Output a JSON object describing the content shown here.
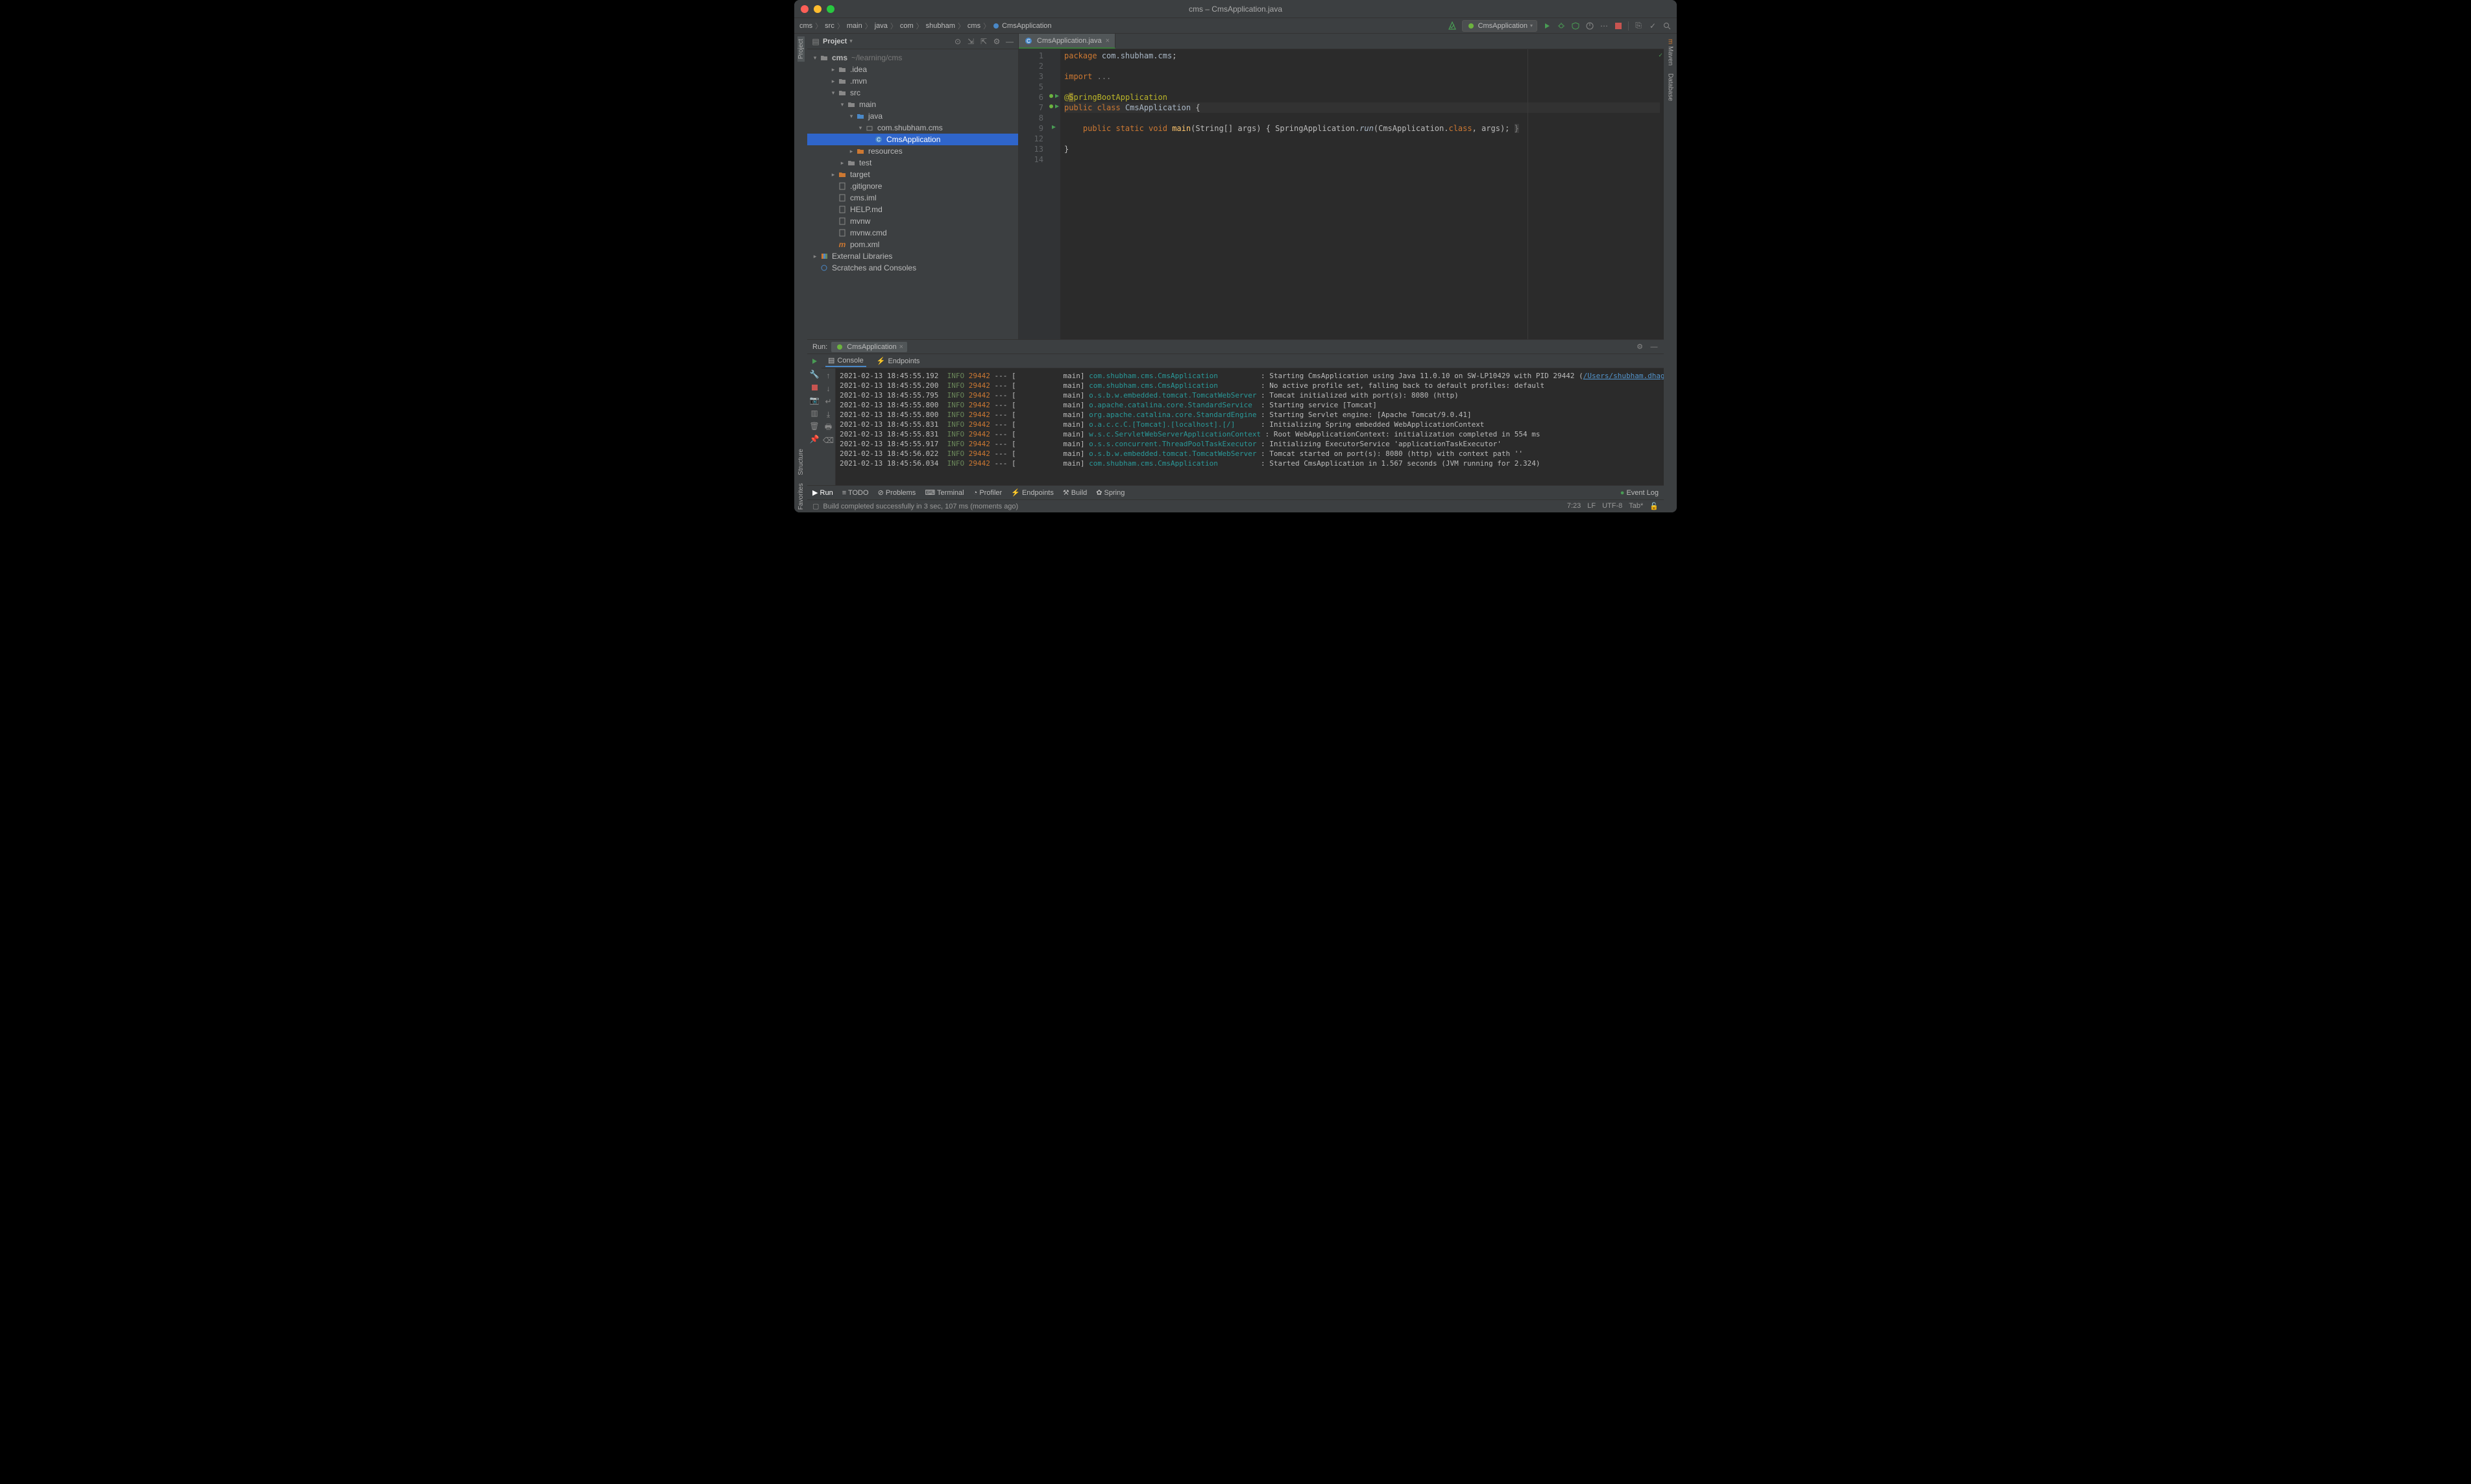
{
  "window": {
    "title": "cms – CmsApplication.java"
  },
  "breadcrumb": [
    "cms",
    "src",
    "main",
    "java",
    "com",
    "shubham",
    "cms",
    "CmsApplication"
  ],
  "runConfig": "CmsApplication",
  "sidebar": {
    "title": "Project",
    "rootName": "cms",
    "rootPath": "~/learning/cms",
    "items": [
      {
        "label": ".idea",
        "indent": 2,
        "exp": true,
        "icon": "folder"
      },
      {
        "label": ".mvn",
        "indent": 2,
        "exp": true,
        "icon": "folder"
      },
      {
        "label": "src",
        "indent": 2,
        "exp": false,
        "icon": "folder",
        "open": true
      },
      {
        "label": "main",
        "indent": 3,
        "exp": false,
        "icon": "folder",
        "open": true
      },
      {
        "label": "java",
        "indent": 4,
        "exp": false,
        "icon": "folder-src",
        "open": true
      },
      {
        "label": "com.shubham.cms",
        "indent": 5,
        "exp": false,
        "icon": "package",
        "open": true
      },
      {
        "label": "CmsApplication",
        "indent": 6,
        "exp": null,
        "icon": "class",
        "selected": true
      },
      {
        "label": "resources",
        "indent": 4,
        "exp": true,
        "icon": "folder-res"
      },
      {
        "label": "test",
        "indent": 3,
        "exp": true,
        "icon": "folder"
      },
      {
        "label": "target",
        "indent": 2,
        "exp": true,
        "icon": "folder-excl"
      },
      {
        "label": ".gitignore",
        "indent": 2,
        "exp": null,
        "icon": "file"
      },
      {
        "label": "cms.iml",
        "indent": 2,
        "exp": null,
        "icon": "file"
      },
      {
        "label": "HELP.md",
        "indent": 2,
        "exp": null,
        "icon": "file-md"
      },
      {
        "label": "mvnw",
        "indent": 2,
        "exp": null,
        "icon": "file"
      },
      {
        "label": "mvnw.cmd",
        "indent": 2,
        "exp": null,
        "icon": "file"
      },
      {
        "label": "pom.xml",
        "indent": 2,
        "exp": null,
        "icon": "file-maven"
      }
    ],
    "libs": "External Libraries",
    "scratches": "Scratches and Consoles"
  },
  "editor": {
    "tab": "CmsApplication.java",
    "lines": [
      {
        "n": 1,
        "html": "<span class='kw'>package</span> <span class='pkg'>com.shubham.cms</span>;"
      },
      {
        "n": 2,
        "html": ""
      },
      {
        "n": 3,
        "html": "<span class='kw'>import</span> <span class='dim2'>...</span>"
      },
      {
        "n": 5,
        "html": ""
      },
      {
        "n": 6,
        "html": "<span class='ann'>@<span style='background:#665c33'>S</span>pringBootApplication</span>",
        "icons": "spring-run"
      },
      {
        "n": 7,
        "html": "<span class='kw'>public class</span> <span class='pl'>CmsApplication</span> {",
        "hl": true,
        "icons": "spring-run"
      },
      {
        "n": 8,
        "html": ""
      },
      {
        "n": 9,
        "html": "    <span class='kw'>public static void</span> <span class='str-fn'>main</span>(String[] args) { SpringApplication.<span class='it'>run</span>(CmsApplication.<span class='kw'>class</span>, args); <span class='dim2' style='background:#3a3a3a'>}</span>",
        "icons": "run"
      },
      {
        "n": 12,
        "html": ""
      },
      {
        "n": 13,
        "html": "}"
      },
      {
        "n": 14,
        "html": ""
      }
    ]
  },
  "run": {
    "label": "Run:",
    "config": "CmsApplication",
    "tabs": {
      "console": "Console",
      "endpoints": "Endpoints"
    },
    "logs": [
      {
        "ts": "2021-02-13 18:45:55.192",
        "lvl": "INFO",
        "pid": "29442",
        "sep": "--- [           main]",
        "logger": "com.shubham.cms.CmsApplication         ",
        "msg": ": Starting CmsApplication using Java 11.0.10 on SW-LP10429 with PID 29442 (",
        "link": "/Users/shubham.dhage/learning/cms/tar"
      },
      {
        "ts": "2021-02-13 18:45:55.200",
        "lvl": "INFO",
        "pid": "29442",
        "sep": "--- [           main]",
        "logger": "com.shubham.cms.CmsApplication         ",
        "msg": ": No active profile set, falling back to default profiles: default"
      },
      {
        "ts": "2021-02-13 18:45:55.795",
        "lvl": "INFO",
        "pid": "29442",
        "sep": "--- [           main]",
        "logger": "o.s.b.w.embedded.tomcat.TomcatWebServer",
        "msg": ": Tomcat initialized with port(s): 8080 (http)"
      },
      {
        "ts": "2021-02-13 18:45:55.800",
        "lvl": "INFO",
        "pid": "29442",
        "sep": "--- [           main]",
        "logger": "o.apache.catalina.core.StandardService ",
        "msg": ": Starting service [Tomcat]"
      },
      {
        "ts": "2021-02-13 18:45:55.800",
        "lvl": "INFO",
        "pid": "29442",
        "sep": "--- [           main]",
        "logger": "org.apache.catalina.core.StandardEngine",
        "msg": ": Starting Servlet engine: [Apache Tomcat/9.0.41]"
      },
      {
        "ts": "2021-02-13 18:45:55.831",
        "lvl": "INFO",
        "pid": "29442",
        "sep": "--- [           main]",
        "logger": "o.a.c.c.C.[Tomcat].[localhost].[/]     ",
        "msg": ": Initializing Spring embedded WebApplicationContext"
      },
      {
        "ts": "2021-02-13 18:45:55.831",
        "lvl": "INFO",
        "pid": "29442",
        "sep": "--- [           main]",
        "logger": "w.s.c.ServletWebServerApplicationContext",
        "msg": ": Root WebApplicationContext: initialization completed in 554 ms"
      },
      {
        "ts": "2021-02-13 18:45:55.917",
        "lvl": "INFO",
        "pid": "29442",
        "sep": "--- [           main]",
        "logger": "o.s.s.concurrent.ThreadPoolTaskExecutor",
        "msg": ": Initializing ExecutorService 'applicationTaskExecutor'"
      },
      {
        "ts": "2021-02-13 18:45:56.022",
        "lvl": "INFO",
        "pid": "29442",
        "sep": "--- [           main]",
        "logger": "o.s.b.w.embedded.tomcat.TomcatWebServer",
        "msg": ": Tomcat started on port(s): 8080 (http) with context path ''"
      },
      {
        "ts": "2021-02-13 18:45:56.034",
        "lvl": "INFO",
        "pid": "29442",
        "sep": "--- [           main]",
        "logger": "com.shubham.cms.CmsApplication         ",
        "msg": ": Started CmsApplication in 1.567 seconds (JVM running for 2.324)"
      }
    ]
  },
  "bottom": {
    "run": "Run",
    "todo": "TODO",
    "problems": "Problems",
    "terminal": "Terminal",
    "profiler": "Profiler",
    "endpoints": "Endpoints",
    "build": "Build",
    "spring": "Spring",
    "eventlog": "Event Log"
  },
  "status": {
    "msg": "Build completed successfully in 3 sec, 107 ms (moments ago)",
    "pos": "7:23",
    "lf": "LF",
    "enc": "UTF-8",
    "tab": "Tab*"
  },
  "leftStrip": [
    "Project",
    "Structure",
    "Favorites"
  ],
  "rightStrip": [
    "Maven",
    "Database"
  ]
}
